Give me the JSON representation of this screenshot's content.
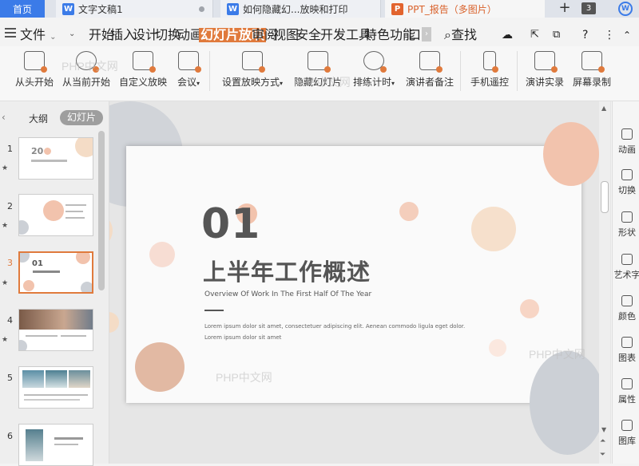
{
  "tabs": [
    {
      "label": "首页"
    },
    {
      "label": "文字文稿1",
      "icon": "W"
    },
    {
      "label": "如何隐藏幻...放映和打印",
      "icon": "W"
    },
    {
      "label": "PPT_报告（多图片）",
      "icon": "P"
    }
  ],
  "tabbar": {
    "new_tab": "+",
    "count": "3",
    "logo": "W"
  },
  "menu": {
    "file": "文件",
    "items": [
      "开始",
      "插入",
      "设计",
      "切换",
      "动画",
      "幻灯片放映",
      "审阅",
      "视图",
      "安全",
      "开发工具",
      "特色功能",
      "口"
    ],
    "active_index": 5,
    "search": "查找",
    "help": "?",
    "more": "⋮"
  },
  "ribbon": {
    "buttons": [
      "从头开始",
      "从当前开始",
      "自定义放映",
      "会议",
      "设置放映方式",
      "隐藏幻灯片",
      "排练计时",
      "演讲者备注",
      "手机遥控",
      "演讲实录",
      "屏幕录制"
    ]
  },
  "left_panel": {
    "outline_tab": "大纲",
    "slides_tab": "幻灯片",
    "slides": [
      {
        "num": "1",
        "star": "★",
        "label": "20"
      },
      {
        "num": "2",
        "star": "★",
        "label": ""
      },
      {
        "num": "3",
        "star": "★",
        "label": "01"
      },
      {
        "num": "4",
        "star": "★",
        "label": ""
      },
      {
        "num": "5",
        "star": "",
        "label": ""
      },
      {
        "num": "6",
        "star": "",
        "label": ""
      }
    ],
    "selected_index": 2
  },
  "slide": {
    "number": "01",
    "title": "上半年工作概述",
    "subtitle": "Overview Of Work In The First Half Of The Year",
    "body": "Lorem ipsum dolor sit amet, consectetuer adipiscing elit. Aenean commodo ligula eget dolor. Lorem ipsum dolor sit amet"
  },
  "watermarks": [
    "PHP中文网",
    "PHP中文网",
    "PHP中文网",
    "PHP中文网"
  ],
  "right_panel": {
    "items": [
      "动画",
      "切换",
      "形状",
      "艺术字",
      "颜色",
      "图表",
      "属性",
      "图库"
    ]
  },
  "colors": {
    "accent": "#e07a3c",
    "tab_blue": "#3b7be8",
    "peach": "#f2c3ad",
    "grey_circle": "#ccd0d6",
    "beige": "#f4dcc6"
  }
}
